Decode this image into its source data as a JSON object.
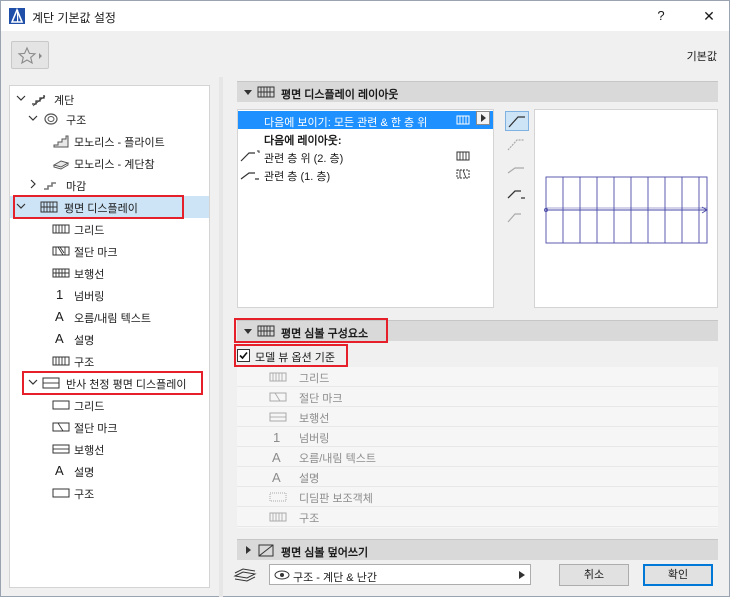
{
  "window": {
    "title": "계단 기본값 설정",
    "help": "?",
    "close": "✕"
  },
  "toolbar": {
    "defaults_label": "기본값"
  },
  "tree": {
    "root": "계단",
    "structure": "구조",
    "mono_flight": "모노리스 - 플라이트",
    "mono_landing": "모노리스 - 계단참",
    "finish": "마감",
    "floor_plan_display": "평면 디스플레이",
    "fp_items": [
      "그리드",
      "절단 마크",
      "보행선",
      "넘버링",
      "오름/내림 텍스트",
      "설명",
      "구조"
    ],
    "rcp_display": "반사 천정 평면 디스플레이",
    "rcp_items": [
      "그리드",
      "절단 마크",
      "보행선",
      "설명",
      "구조"
    ]
  },
  "sections": {
    "layout": "평면 디스플레이 레이아웃",
    "symbol_components": "평면 심볼 구성요소",
    "symbol_override": "평면 심볼 덮어쓰기"
  },
  "layout_list": {
    "show_on": "다음에 보이기: 모든 관련 & 한 층 위",
    "layout_on": "다음에 레이아웃:",
    "upper": "관련 층 위 (2. 층)",
    "current": "관련 층 (1. 층)"
  },
  "symbol": {
    "model_view_option": "모델 뷰 옵션 기준",
    "items": [
      "그리드",
      "절단 마크",
      "보행선",
      "넘버링",
      "오름/내림 텍스트",
      "설명",
      "디딤판 보조객체",
      "구조"
    ]
  },
  "bottom": {
    "dropdown_value": "구조 - 계단 & 난간",
    "cancel": "취소",
    "ok": "확인"
  },
  "colors": {
    "accent": "#1e90ff",
    "selection": "#cde4f7",
    "highlight_box": "#e5202a",
    "preview_lines": "#4a4aa8"
  }
}
